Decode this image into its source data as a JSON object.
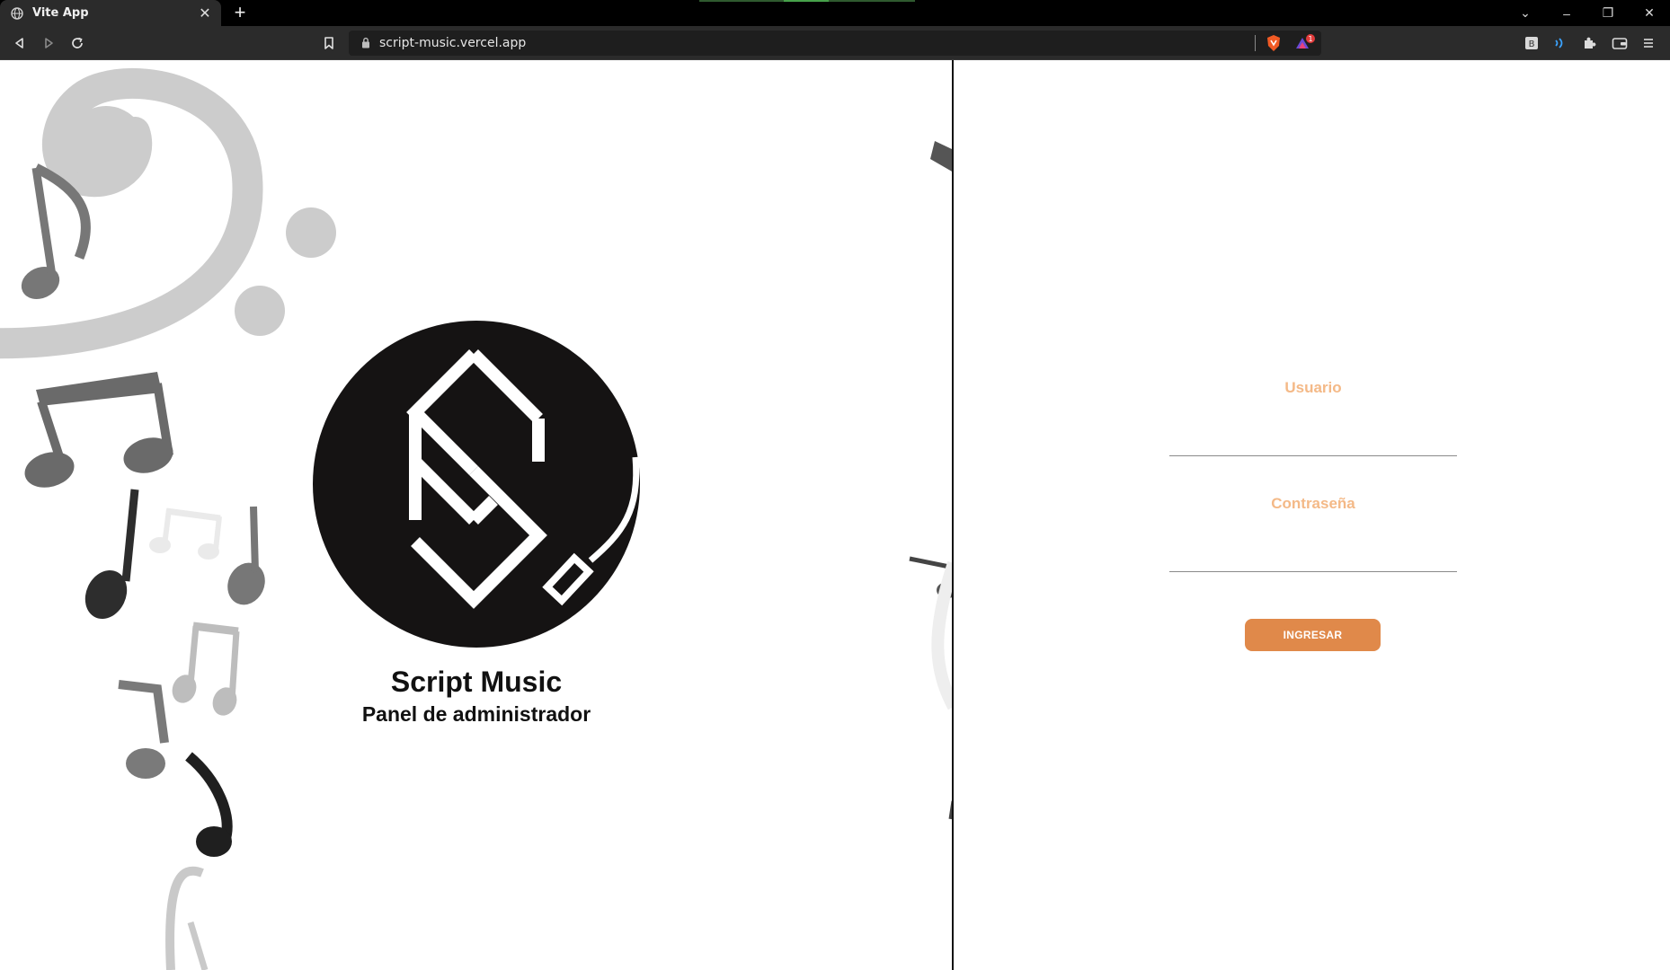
{
  "browser": {
    "tab_title": "Vite App",
    "tab_close": "✕",
    "new_tab": "+",
    "url": "script-music.vercel.app",
    "window_controls": {
      "chevron": "⌄",
      "minimize": "–",
      "restore": "❐",
      "close": "✕"
    },
    "extension_badge": "1"
  },
  "brand": {
    "title": "Script Music",
    "subtitle": "Panel de administrador"
  },
  "login": {
    "user_label": "Usuario",
    "user_value": "",
    "password_label": "Contraseña",
    "password_value": "",
    "submit_label": "INGRESAR"
  },
  "colors": {
    "accent": "#e0894a",
    "label": "#f4b987",
    "logo_bg": "#151313"
  }
}
